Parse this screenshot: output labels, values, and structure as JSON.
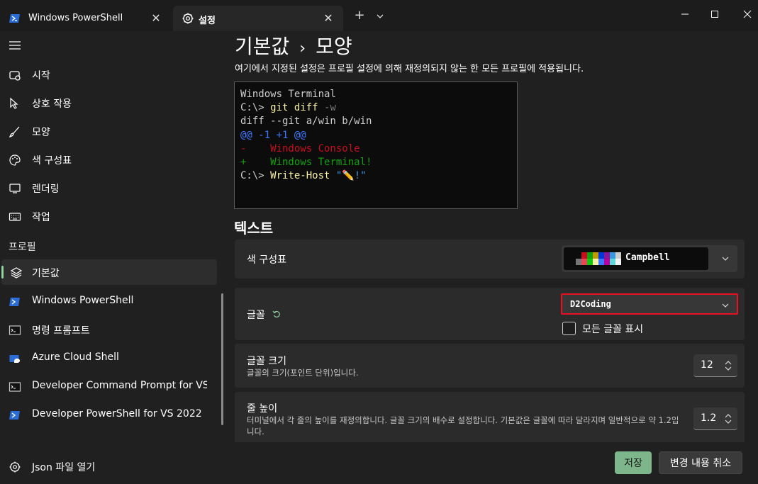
{
  "tabs": [
    {
      "title": "Windows PowerShell",
      "icon": "powershell-icon",
      "close": "✕"
    },
    {
      "title": "설정",
      "icon": "gear-icon",
      "close": "✕"
    }
  ],
  "titlebar": {
    "new_tab": "+"
  },
  "sidebar": {
    "items": [
      {
        "label": "시작",
        "icon": "rocket-icon"
      },
      {
        "label": "상호 작용",
        "icon": "cursor-icon"
      },
      {
        "label": "모양",
        "icon": "brush-icon"
      },
      {
        "label": "색 구성표",
        "icon": "palette-icon"
      },
      {
        "label": "렌더링",
        "icon": "monitor-icon"
      },
      {
        "label": "작업",
        "icon": "keyboard-icon"
      }
    ],
    "section_header": "프로필",
    "profiles": [
      {
        "label": "기본값",
        "icon": "layers-icon"
      },
      {
        "label": "Windows PowerShell",
        "icon": "powershell-icon"
      },
      {
        "label": "명령 프롬프트",
        "icon": "cmd-icon"
      },
      {
        "label": "Azure Cloud Shell",
        "icon": "azure-icon"
      },
      {
        "label": "Developer Command Prompt for VS 2022",
        "icon": "cmd-icon"
      },
      {
        "label": "Developer PowerShell for VS 2022",
        "icon": "powershell-icon"
      }
    ],
    "json_label": "Json 파일 열기"
  },
  "main": {
    "breadcrumb_parent": "기본값",
    "breadcrumb_sep": "›",
    "breadcrumb_current": "모양",
    "subtitle": "여기에서 지정된 설정은 프로필 설정에 의해 재정의되지 않는 한 모든 프로필에 적용됩니다.",
    "preview": {
      "line1": "Windows Terminal",
      "line2_prompt": "C:\\> ",
      "line2_cmd": "git diff ",
      "line2_flag": "-w",
      "line3": "diff --git a/win b/win",
      "line4": "@@ -1 +1 @@",
      "line5": "-    Windows Console",
      "line6": "+    Windows Terminal!",
      "line7_prompt": "C:\\> ",
      "line7_cmd": "Write-Host ",
      "line7_str_open": "\"",
      "line7_emoji": "✏️",
      "line7_str_close": "!\""
    },
    "section_title": "텍스트",
    "color_scheme": {
      "label": "색 구성표",
      "value": "Campbell",
      "swatches": [
        "#0c0c0c",
        "#c50f1f",
        "#13a10e",
        "#c19c00",
        "#0037da",
        "#881798",
        "#3a96dd",
        "#cccccc",
        "#767676",
        "#e74856",
        "#16c60c",
        "#f9f1a5",
        "#3b78ff",
        "#b4009e",
        "#61d6d6",
        "#f2f2f2"
      ]
    },
    "font_face": {
      "label": "글꼴",
      "value": "D2Coding",
      "show_all": "모든 글꼴 표시"
    },
    "font_size": {
      "label": "글꼴 크기",
      "desc": "글꼴의 크기(포인트 단위)입니다.",
      "value": "12"
    },
    "line_height": {
      "label": "줄 높이",
      "desc": "터미널에서 각 줄의 높이를 재정의합니다. 글꼴 크기의 배수로 설정합니다. 기본값은 글꼴에 따라 달라지며 일반적으로 약 1.2입니다.",
      "value": "1.2"
    }
  },
  "footer": {
    "save": "저장",
    "discard": "변경 내용 취소"
  },
  "colors": {
    "accent": "#8fd19e",
    "highlight": "#e81123"
  }
}
